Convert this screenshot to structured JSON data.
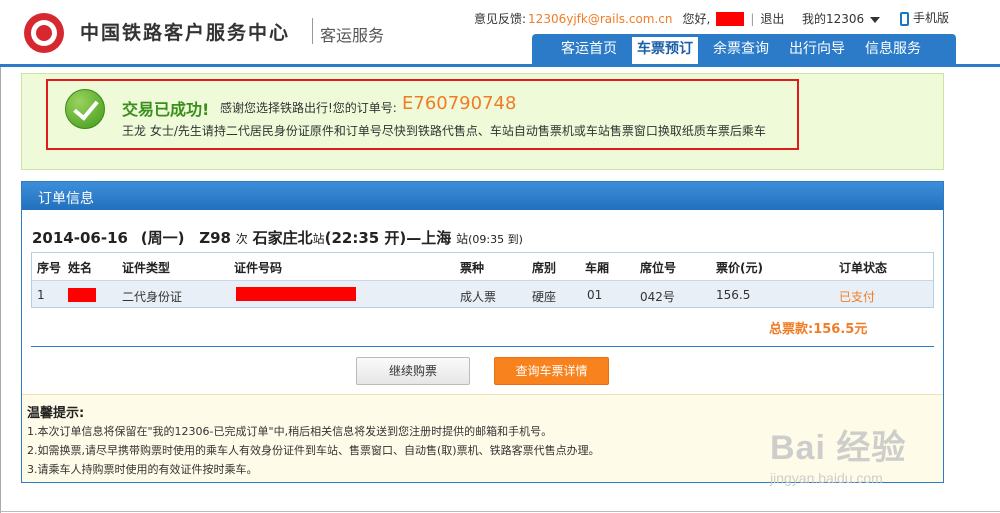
{
  "header": {
    "site_title": "中国铁路客户服务中心",
    "site_sub": "客运服务",
    "feedback_label": "意见反馈:",
    "feedback_email": "12306yjfk@rails.com.cn",
    "greeting": "您好,",
    "logout": "退出",
    "my12306": "我的12306",
    "mobile": "手机版"
  },
  "nav": {
    "items": [
      "客运首页",
      "车票预订",
      "余票查询",
      "出行向导",
      "信息服务"
    ],
    "active": "车票预订"
  },
  "success": {
    "title": "交易已成功!",
    "thanks": "感谢您选择铁路出行!您的订单号:",
    "order_no": "E760790748",
    "note": "王龙 女士/先生请持二代居民身份证原件和订单号尽快到铁路代售点、车站自动售票机或车站售票窗口换取纸质车票后乘车"
  },
  "order": {
    "panel_title": "订单信息",
    "trip": {
      "date": "2014-06-16",
      "weekday": "(周一)",
      "train_no": "Z98",
      "train_suffix": "次",
      "from": "石家庄北",
      "from_suffix": "站",
      "depart": "(22:35 开)",
      "dash": "—",
      "to": "上海",
      "to_suffix": "站",
      "arrive": "(09:35 到)"
    },
    "columns": [
      "序号",
      "姓名",
      "证件类型",
      "证件号码",
      "票种",
      "席别",
      "车厢",
      "席位号",
      "票价(元)",
      "订单状态"
    ],
    "rows": [
      {
        "no": "1",
        "name": "",
        "id_type": "二代身份证",
        "id_no": "",
        "ticket_type": "成人票",
        "seat_class": "硬座",
        "car": "01",
        "seat_no": "042号",
        "price": "156.5",
        "status": "已支付"
      }
    ],
    "total": "总票款:156.5元",
    "buttons": {
      "continue": "继续购票",
      "query": "查询车票详情"
    }
  },
  "tips": {
    "title": "温馨提示:",
    "items": [
      "1.本次订单信息将保留在\"我的12306-已完成订单\"中,稍后相关信息将发送到您注册时提供的邮箱和手机号。",
      "2.如需换票,请尽早携带购票时使用的乘车人有效身份证件到车站、售票窗口、自动售(取)票机、铁路客票代售点办理。",
      "3.请乘车人持购票时使用的有效证件按时乘车。"
    ]
  },
  "watermark": {
    "main": "Bai 经验",
    "url": "jingyan.baidu.com"
  },
  "colors": {
    "brand_blue": "#2b7bc8",
    "accent_orange": "#f17c26",
    "success_green": "#3a8f1c",
    "highlight_red": "#e01b1b"
  }
}
